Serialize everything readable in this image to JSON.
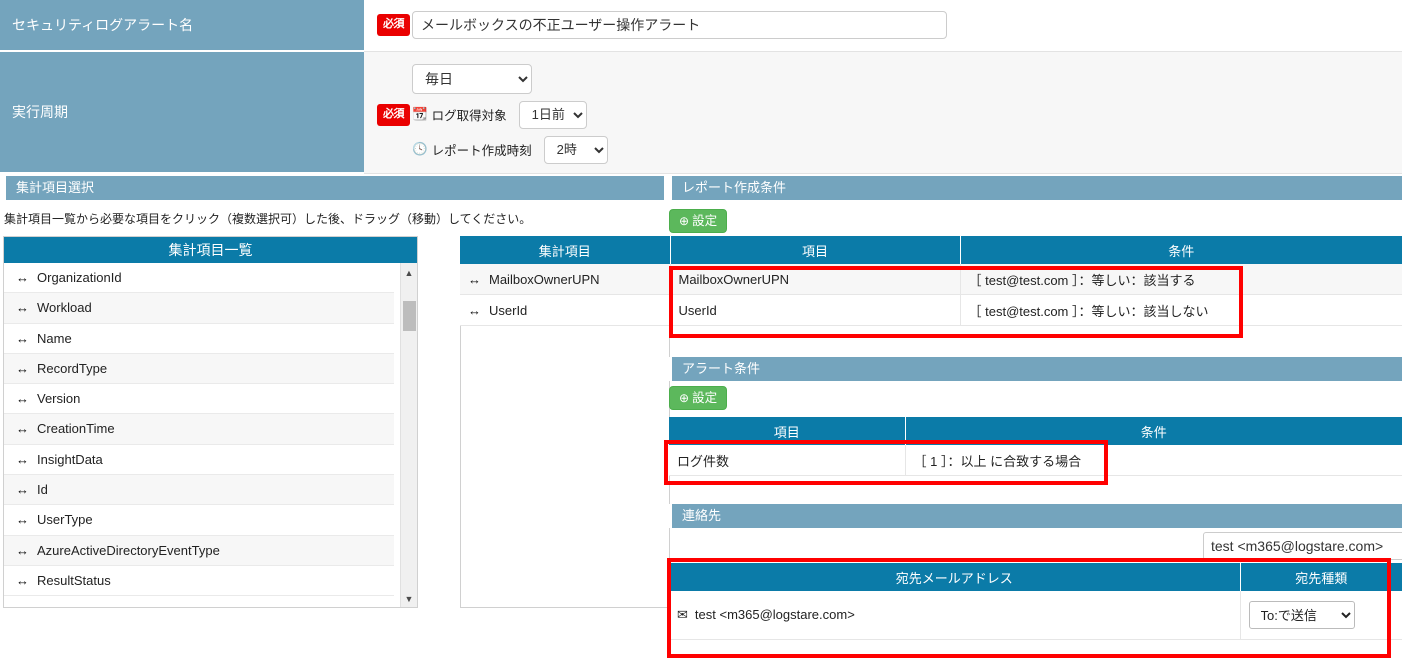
{
  "form": {
    "rows": [
      {
        "label": "セキュリティログアラート名",
        "required_badge": "必須"
      },
      {
        "label": "実行周期",
        "required_badge": "必須"
      }
    ],
    "alert_name": {
      "value": "メールボックスの不正ユーザー操作アラート",
      "placeholder": ""
    },
    "frequency": {
      "value": "毎日"
    },
    "log_target": {
      "label": "ログ取得対象",
      "value": "1日前",
      "icon": "calendar-icon"
    },
    "report_time": {
      "label": "レポート作成時刻",
      "value": "2時",
      "icon": "clock-icon"
    }
  },
  "aggregate_select": {
    "section_title": "集計項目選択",
    "helper": "集計項目一覧から必要な項目をクリック（複数選択可）した後、ドラッグ（移動）してください。",
    "list_title": "集計項目一覧",
    "items": [
      "OrganizationId",
      "Workload",
      "Name",
      "RecordType",
      "Version",
      "CreationTime",
      "InsightData",
      "Id",
      "UserType",
      "AzureActiveDirectoryEventType",
      "ResultStatus"
    ]
  },
  "report_conditions": {
    "section_title": "レポート作成条件",
    "set_button": "設定",
    "headers": [
      "集計項目",
      "項目",
      "条件"
    ],
    "rows": [
      {
        "aggregate": "MailboxOwnerUPN",
        "item": "MailboxOwnerUPN",
        "condition": "［ test@test.com ］：等しい：該当する"
      },
      {
        "aggregate": "UserId",
        "item": "UserId",
        "condition": "［ test@test.com ］：等しい：該当しない"
      }
    ]
  },
  "alert_conditions": {
    "section_title": "アラート条件",
    "set_button": "設定",
    "headers": [
      "項目",
      "条件"
    ],
    "rows": [
      {
        "item": "ログ件数",
        "condition": "［ 1 ］：以上 に合致する場合"
      }
    ]
  },
  "contacts": {
    "section_title": "連絡先",
    "search_value": "test <m365@logstare.com>",
    "headers": [
      "宛先メールアドレス",
      "宛先種類"
    ],
    "rows": [
      {
        "address": "test <m365@logstare.com>",
        "dest_type": "To:で送信"
      }
    ]
  },
  "colors": {
    "section_bar": "#74a4bd",
    "table_header": "#0b7ba8",
    "required_badge": "#ea0000",
    "set_button": "#5cb85c",
    "highlight": "#ff0000"
  }
}
